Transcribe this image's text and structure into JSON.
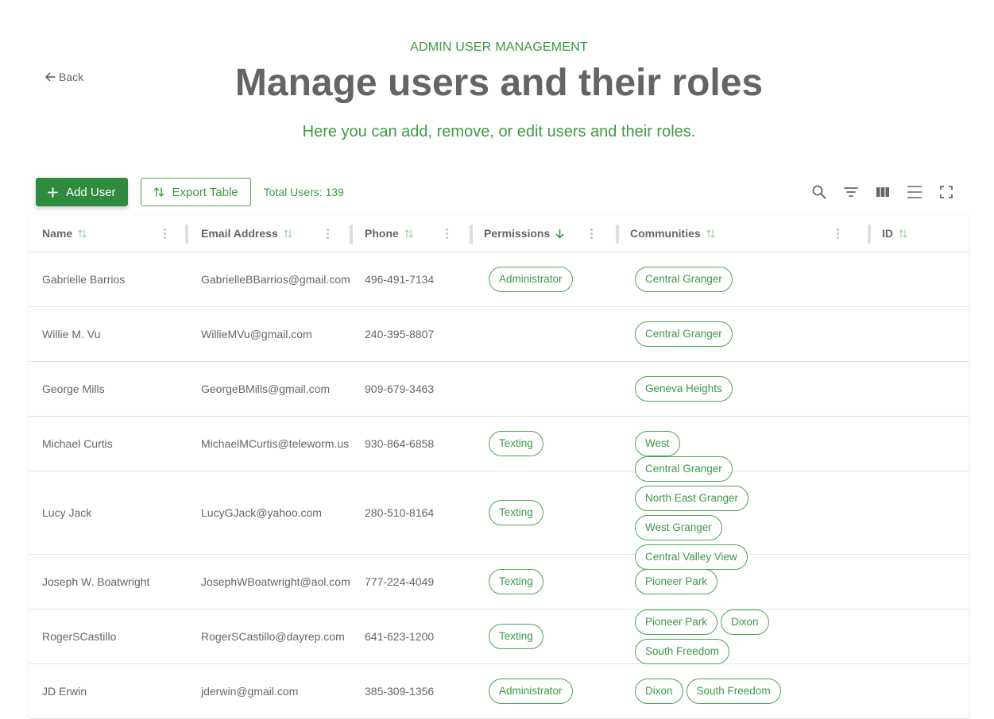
{
  "header": {
    "back_label": "Back",
    "eyebrow": "ADMIN USER MANAGEMENT",
    "title": "Manage users and their roles",
    "subtitle": "Here you can add, remove, or edit users and their roles."
  },
  "toolbar": {
    "add_label": "Add User",
    "export_label": "Export Table",
    "total_label": "Total Users: 139",
    "icons": [
      "search-icon",
      "filter-icon",
      "columns-icon",
      "density-icon",
      "fullscreen-icon"
    ]
  },
  "colors": {
    "accent": "#2e8b3f",
    "accent_text": "#3d9a45",
    "title": "#646464"
  },
  "table": {
    "columns": [
      {
        "key": "name",
        "label": "Name",
        "sort": "none"
      },
      {
        "key": "email",
        "label": "Email Address",
        "sort": "none"
      },
      {
        "key": "phone",
        "label": "Phone",
        "sort": "none"
      },
      {
        "key": "permissions",
        "label": "Permissions",
        "sort": "desc"
      },
      {
        "key": "communities",
        "label": "Communities",
        "sort": "none"
      },
      {
        "key": "id",
        "label": "ID",
        "sort": "none"
      }
    ],
    "rows": [
      {
        "name": "Gabrielle Barrios",
        "email": "GabrielleBBarrios@gmail.com",
        "phone": "496-491-7134",
        "permissions": [
          "Administrator"
        ],
        "communities": [
          "Central Granger"
        ]
      },
      {
        "name": "Willie M. Vu",
        "email": "WillieMVu@gmail.com",
        "phone": "240-395-8807",
        "permissions": [],
        "communities": [
          "Central Granger"
        ]
      },
      {
        "name": "George Mills",
        "email": "GeorgeBMills@gmail.com",
        "phone": "909-679-3463",
        "permissions": [],
        "communities": [
          "Geneva Heights"
        ]
      },
      {
        "name": "Michael Curtis",
        "email": "MichaelMCurtis@teleworm.us",
        "phone": "930-864-6858",
        "permissions": [
          "Texting"
        ],
        "communities": [
          "West"
        ]
      },
      {
        "name": "Lucy Jack",
        "email": "LucyGJack@yahoo.com",
        "phone": "280-510-8164",
        "permissions": [
          "Texting"
        ],
        "communities": [
          "Central Granger",
          "North East Granger",
          "West Granger",
          "Central Valley View"
        ]
      },
      {
        "name": "Joseph W. Boatwright",
        "email": "JosephWBoatwright@aol.com",
        "phone": "777-224-4049",
        "permissions": [
          "Texting"
        ],
        "communities": [
          "Pioneer Park"
        ]
      },
      {
        "name": "RogerSCastillo",
        "email": "RogerSCastillo@dayrep.com",
        "phone": "641-623-1200",
        "permissions": [
          "Texting"
        ],
        "communities": [
          "Pioneer Park",
          "Dixon",
          "South Freedom"
        ]
      },
      {
        "name": "JD Erwin",
        "email": "jderwin@gmail.com",
        "phone": "385-309-1356",
        "permissions": [
          "Administrator"
        ],
        "communities": [
          "Dixon",
          "South Freedom"
        ]
      }
    ]
  }
}
